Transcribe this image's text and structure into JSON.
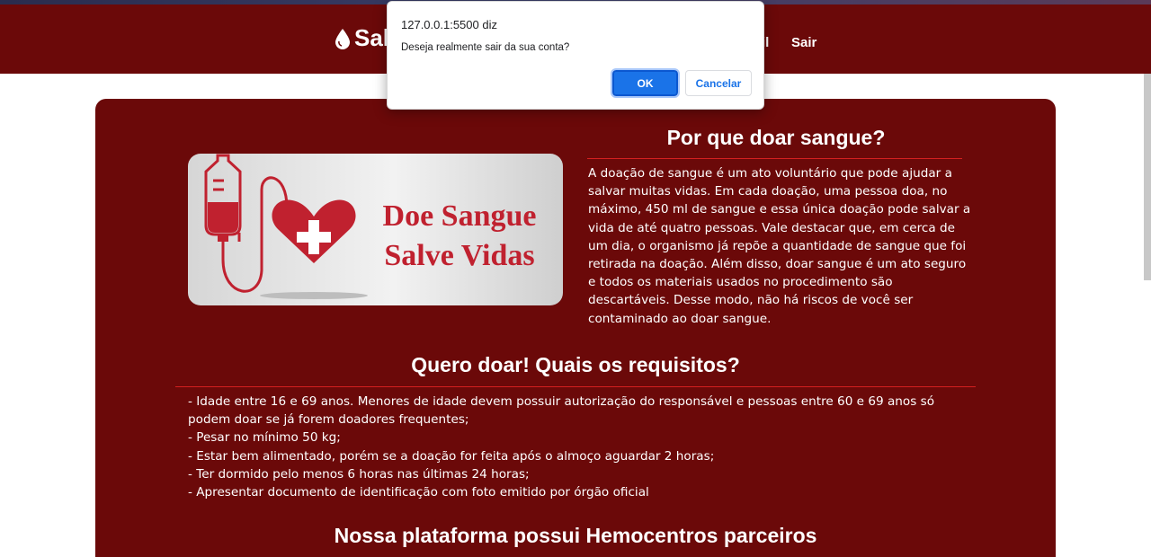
{
  "header": {
    "brand_text": "Sal",
    "nav_partial": "il",
    "nav_logout": "Sair"
  },
  "card": {
    "banner_line1": "Doe Sangue",
    "banner_line2": "Salve Vidas",
    "why_title": "Por que doar sangue?",
    "why_text": "A doação de sangue é um ato voluntário que pode ajudar a salvar muitas vidas. Em cada doação, uma pessoa doa, no máximo, 450 ml de sangue e essa única doação pode salvar a vida de até quatro pessoas. Vale destacar que, em cerca de um dia, o organismo já repõe a quantidade de sangue que foi retirada na doação. Além disso, doar sangue é um ato seguro e todos os materiais usados no procedimento são descartáveis. Desse modo, não há riscos de você ser contaminado ao doar sangue.",
    "requirements_title": "Quero doar! Quais os requisitos?",
    "requirements": [
      "- Idade entre 16 e 69 anos. Menores de idade devem possuir autorização do responsável e pessoas entre 60 e 69 anos só podem doar se já forem doadores frequentes;",
      "- Pesar no mínimo 50 kg;",
      "- Estar bem alimentado, porém se a doação for feita após o almoço aguardar 2 horas;",
      "- Ter dormido pelo menos 6 horas nas últimas 24 horas;",
      "- Apresentar documento de identificação com foto emitido por órgão oficial"
    ],
    "partners_title": "Nossa plataforma possui Hemocentros parceiros"
  },
  "dialog": {
    "origin": "127.0.0.1:5500 diz",
    "message": "Deseja realmente sair da sua conta?",
    "ok_label": "OK",
    "cancel_label": "Cancelar"
  },
  "colors": {
    "header_bg": "#6b0909",
    "card_bg": "#6b0909",
    "banner_red": "#c0212f",
    "accent_rule": "#d42020",
    "ok_blue": "#1a73e8"
  },
  "icons": [
    "blood-drop-icon",
    "blood-bag-icon",
    "heart-cross-icon"
  ]
}
